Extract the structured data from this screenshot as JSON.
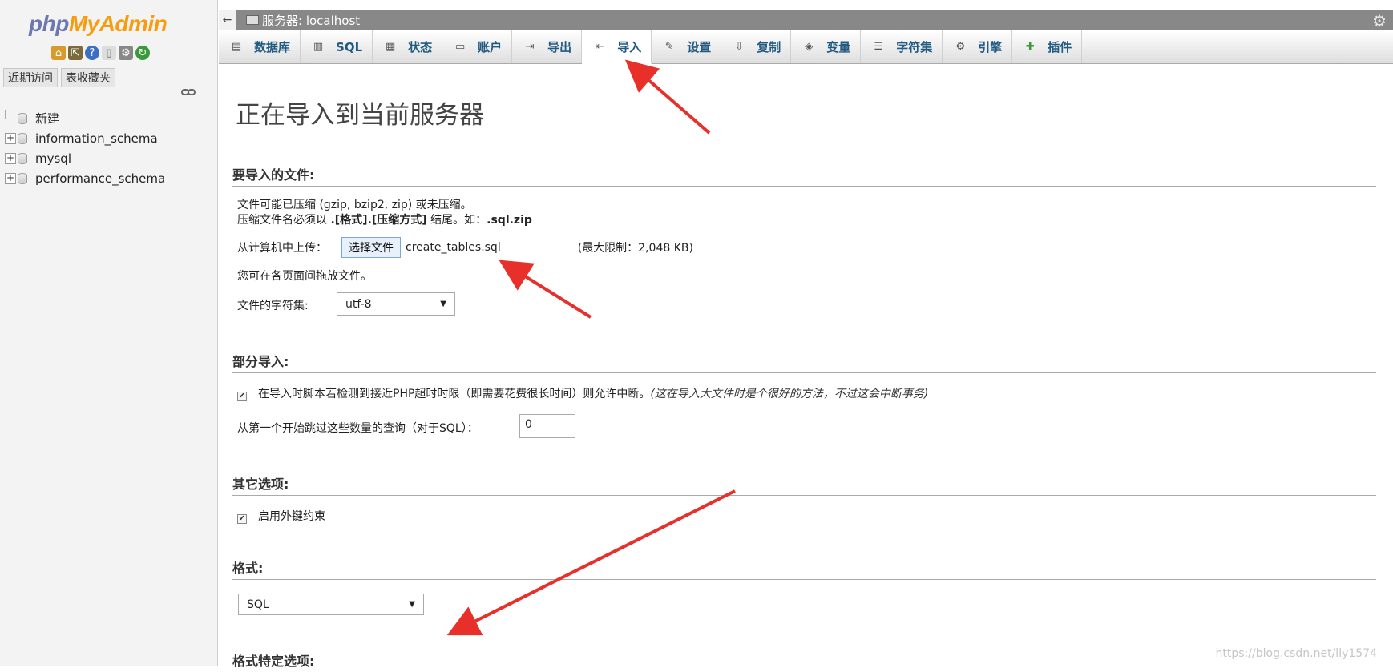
{
  "sidebar": {
    "logo_php": "php",
    "logo_admin": "MyAdmin",
    "tabs": [
      "近期访问",
      "表收藏夹"
    ],
    "tree": [
      {
        "label": "新建",
        "expandable": false
      },
      {
        "label": "information_schema",
        "expandable": true
      },
      {
        "label": "mysql",
        "expandable": true
      },
      {
        "label": "performance_schema",
        "expandable": true
      }
    ]
  },
  "topbar": {
    "back": "←",
    "server_label": "服务器: localhost"
  },
  "tabs": [
    {
      "label": "数据库",
      "icon": "database-icon",
      "glyph": "▤"
    },
    {
      "label": "SQL",
      "icon": "sql-icon",
      "glyph": "▥"
    },
    {
      "label": "状态",
      "icon": "status-icon",
      "glyph": "▦"
    },
    {
      "label": "账户",
      "icon": "users-icon",
      "glyph": "▭"
    },
    {
      "label": "导出",
      "icon": "export-icon",
      "glyph": "⇥"
    },
    {
      "label": "导入",
      "icon": "import-icon",
      "glyph": "⇤",
      "active": true
    },
    {
      "label": "设置",
      "icon": "wrench-icon",
      "glyph": "✎"
    },
    {
      "label": "复制",
      "icon": "replication-icon",
      "glyph": "⇩"
    },
    {
      "label": "变量",
      "icon": "variables-icon",
      "glyph": "◈"
    },
    {
      "label": "字符集",
      "icon": "charset-icon",
      "glyph": "☰"
    },
    {
      "label": "引擎",
      "icon": "engine-icon",
      "glyph": "⚙"
    },
    {
      "label": "插件",
      "icon": "plugin-icon",
      "glyph": "✚"
    }
  ],
  "main": {
    "title": "正在导入到当前服务器",
    "file_section": {
      "heading": "要导入的文件:",
      "line1": "文件可能已压缩 (gzip, bzip2, zip) 或未压缩。",
      "line2_pre": "压缩文件名必须以 ",
      "line2_bold": ".[格式].[压缩方式]",
      "line2_mid": " 结尾。如：",
      "line2_bold2": ".sql.zip",
      "upload_label": "从计算机中上传：",
      "choose_button": "选择文件",
      "file_name": "create_tables.sql",
      "max_limit": "(最大限制：2,048 KB)",
      "drag_hint": "您可在各页面间拖放文件。",
      "charset_label": "文件的字符集:",
      "charset_value": "utf-8"
    },
    "partial_section": {
      "heading": "部分导入:",
      "allow_interrupt": "在导入时脚本若检测到接近PHP超时时限（即需要花费很长时间）则允许中断。",
      "allow_interrupt_hint": "(这在导入大文件时是个很好的方法，不过这会中断事务)",
      "skip_label": "从第一个开始跳过这些数量的查询（对于SQL）：",
      "skip_value": "0"
    },
    "other_section": {
      "heading": "其它选项:",
      "fk_label": "启用外键约束"
    },
    "format_section": {
      "heading": "格式:",
      "format_value": "SQL"
    },
    "format_specific_heading": "格式特定选项:"
  },
  "watermark": "https://blog.csdn.net/lly1574",
  "colors": {
    "annotation_arrow": "#e8302a",
    "tab_text": "#235a81",
    "topbar": "#888888"
  }
}
